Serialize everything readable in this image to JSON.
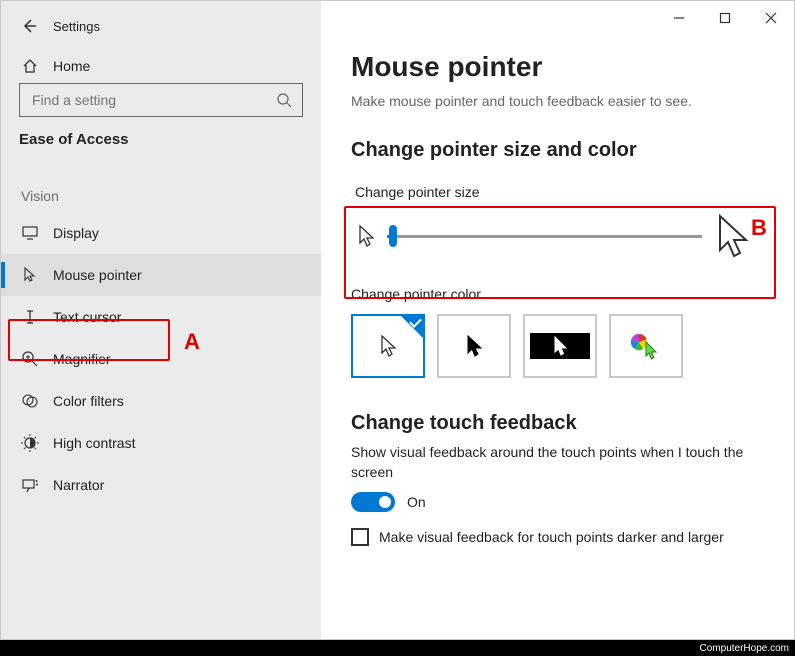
{
  "window": {
    "title": "Settings",
    "back_label": "Back",
    "minimize": "Minimize",
    "maximize": "Maximize",
    "close": "Close"
  },
  "sidebar": {
    "home": "Home",
    "search_placeholder": "Find a setting",
    "category": "Ease of Access",
    "section": "Vision",
    "items": [
      {
        "label": "Display",
        "icon": "monitor-icon"
      },
      {
        "label": "Mouse pointer",
        "icon": "pointer-icon",
        "active": true
      },
      {
        "label": "Text cursor",
        "icon": "text-cursor-icon"
      },
      {
        "label": "Magnifier",
        "icon": "magnifier-icon"
      },
      {
        "label": "Color filters",
        "icon": "color-filters-icon"
      },
      {
        "label": "High contrast",
        "icon": "contrast-icon"
      },
      {
        "label": "Narrator",
        "icon": "narrator-icon"
      }
    ]
  },
  "main": {
    "title": "Mouse pointer",
    "subtitle": "Make mouse pointer and touch feedback easier to see.",
    "size_section": "Change pointer size and color",
    "size_label": "Change pointer size",
    "color_label": "Change pointer color",
    "touch_section": "Change touch feedback",
    "touch_desc": "Show visual feedback around the touch points when I touch the screen",
    "toggle_state": "On",
    "checkbox_label": "Make visual feedback for touch points darker and larger"
  },
  "annotations": {
    "a": "A",
    "b": "B"
  },
  "footer": {
    "credit": "ComputerHope.com"
  }
}
